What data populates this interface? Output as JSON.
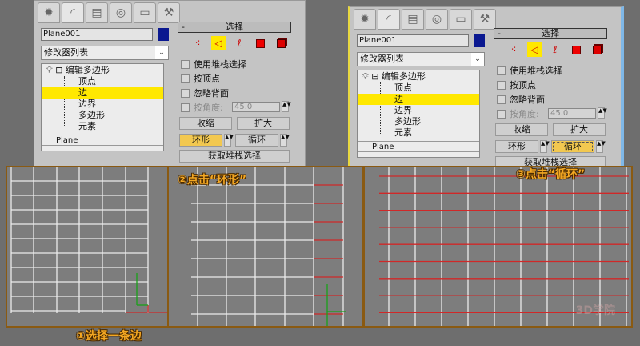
{
  "panels": [
    {
      "tabs": [
        "create-icon",
        "modify-icon",
        "hierarchy-icon",
        "motion-icon",
        "display-icon",
        "utilities-icon"
      ],
      "object_name": "Plane001",
      "object_color": "#0a1890",
      "modifier_list": "修改器列表",
      "stack": {
        "modifier": "编辑多边形",
        "subobjects": [
          "顶点",
          "边",
          "边界",
          "多边形",
          "元素"
        ],
        "selected": "边",
        "base": "Plane"
      },
      "rollout_title": "选择",
      "collapse_symbol": "-",
      "checkboxes": [
        "使用堆栈选择",
        "按顶点",
        "忽略背面"
      ],
      "angle_label": "按角度:",
      "angle_value": "45.0",
      "shrink": "收缩",
      "grow": "扩大",
      "ring": "环形",
      "loop": "循环",
      "get_stack": "获取堆栈选择",
      "active": "ring"
    },
    {
      "tabs": [
        "create-icon",
        "modify-icon",
        "hierarchy-icon",
        "motion-icon",
        "display-icon",
        "utilities-icon"
      ],
      "object_name": "Plane001",
      "object_color": "#0a1890",
      "modifier_list": "修改器列表",
      "stack": {
        "modifier": "编辑多边形",
        "subobjects": [
          "顶点",
          "边",
          "边界",
          "多边形",
          "元素"
        ],
        "selected": "边",
        "base": "Plane"
      },
      "rollout_title": "选择",
      "collapse_symbol": "-",
      "checkboxes": [
        "使用堆栈选择",
        "按顶点",
        "忽略背面"
      ],
      "angle_label": "按角度:",
      "angle_value": "45.0",
      "shrink": "收缩",
      "grow": "扩大",
      "ring": "环形",
      "loop": "循环",
      "get_stack": "获取堆栈选择",
      "active": "loop"
    }
  ],
  "captions": {
    "step1": "①选择一条边",
    "step2": "②点击“环形”",
    "step3": "③点击“循环”"
  },
  "watermark": "3D学院",
  "colors": {
    "selection": "#ffe800",
    "active_button": "#f2c850",
    "selected_edge": "#d02828",
    "viewport_border": "#8a5a12",
    "caption": "#f4a823"
  }
}
